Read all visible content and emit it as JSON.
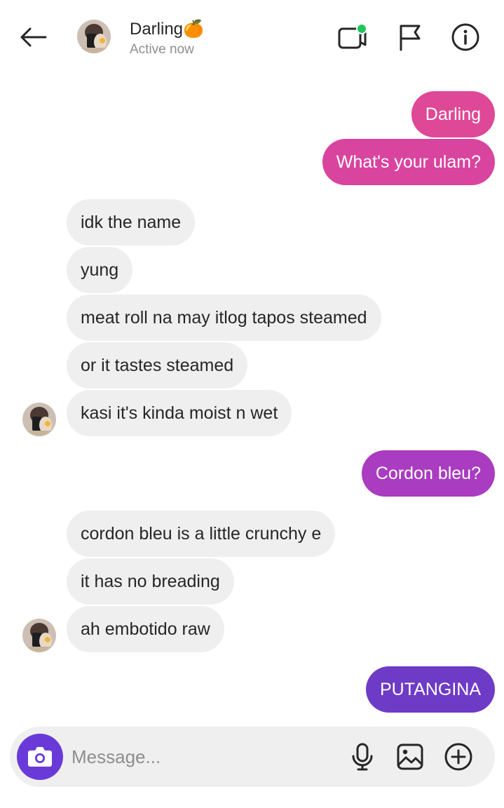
{
  "header": {
    "contact_name": "Darling🍊",
    "status": "Active now",
    "icons": [
      "back-arrow-icon",
      "video-call-icon",
      "flag-icon",
      "info-icon"
    ],
    "online_dot_color": "#22c55e"
  },
  "messages": [
    {
      "from": "me",
      "text": "Darling",
      "color": "#df4896"
    },
    {
      "from": "me",
      "text": "What's your ulam?",
      "color": "#d9449f"
    },
    {
      "from": "them",
      "text": "idk the name"
    },
    {
      "from": "them",
      "text": "yung"
    },
    {
      "from": "them",
      "text": "meat roll na may itlog tapos steamed"
    },
    {
      "from": "them",
      "text": "or it tastes steamed"
    },
    {
      "from": "them",
      "text": "kasi it's kinda moist n wet"
    },
    {
      "from": "me",
      "text": "Cordon bleu?",
      "color": "#a93cc0"
    },
    {
      "from": "them",
      "text": "cordon bleu is a little crunchy e"
    },
    {
      "from": "them",
      "text": "it has no breading"
    },
    {
      "from": "them",
      "text": "ah embotido raw"
    },
    {
      "from": "me",
      "text": "PUTANGINA",
      "color": "#6e3bc6"
    }
  ],
  "composer": {
    "placeholder": "Message...",
    "camera_button_color": "#6a3ad8",
    "icons": [
      "camera-icon",
      "microphone-icon",
      "gallery-icon",
      "add-icon"
    ]
  }
}
